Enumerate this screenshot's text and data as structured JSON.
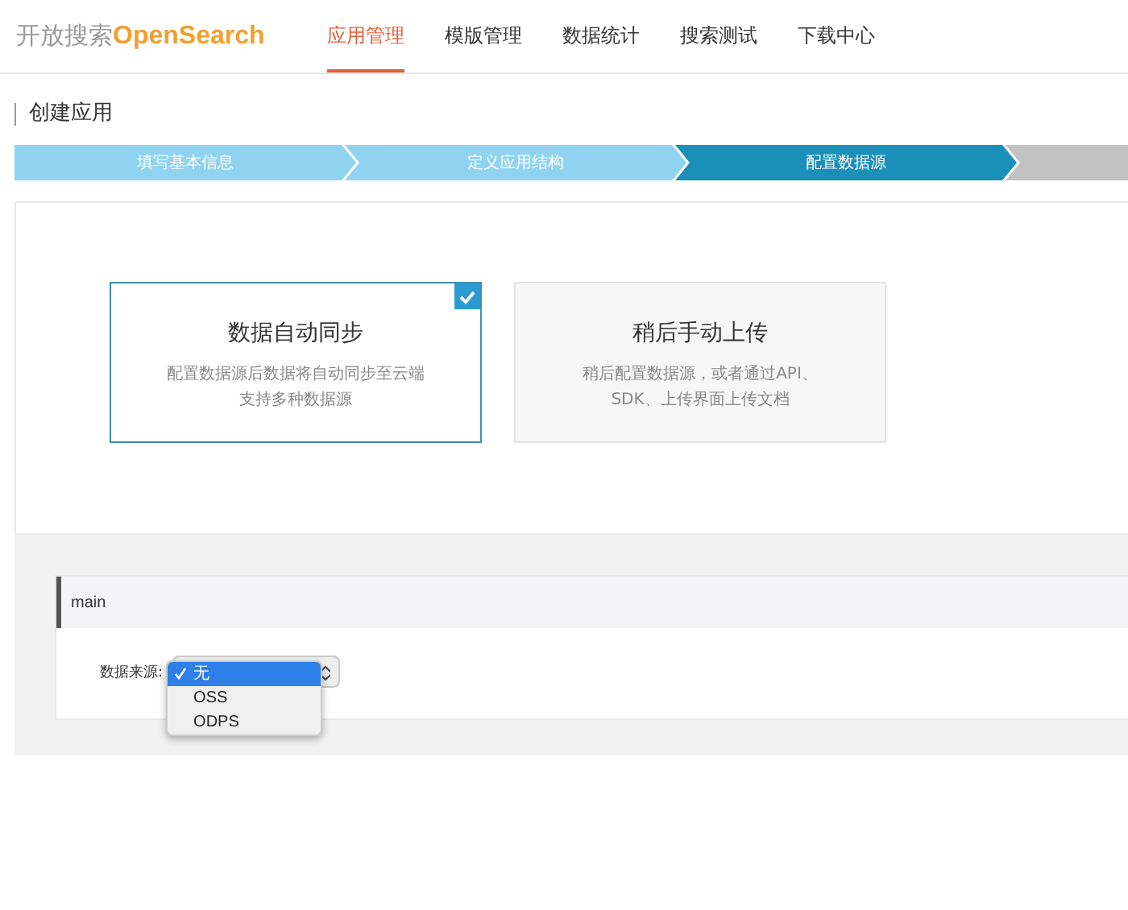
{
  "brand": {
    "prefix": "开放搜索",
    "name": "OpenSearch"
  },
  "nav": [
    {
      "label": "应用管理",
      "selected": true
    },
    {
      "label": "模版管理",
      "selected": false
    },
    {
      "label": "数据统计",
      "selected": false
    },
    {
      "label": "搜索测试",
      "selected": false
    },
    {
      "label": "下载中心",
      "selected": false
    }
  ],
  "page_title": "创建应用",
  "steps": [
    {
      "label": "填写基本信息",
      "done": true,
      "selected": false
    },
    {
      "label": "定义应用结构",
      "done": true,
      "selected": false
    },
    {
      "label": "配置数据源",
      "done": false,
      "selected": true
    },
    {
      "done": false,
      "selected": false
    }
  ],
  "sync_options": [
    {
      "title": "数据自动同步",
      "lines": [
        "配置数据源后数据将自动同步至云端",
        "支持多种数据源"
      ],
      "selected": true
    },
    {
      "title": "稍后手动上传",
      "lines": [
        "稍后配置数据源，或者通过API、",
        "SDK、上传界面上传文档"
      ],
      "selected": false
    }
  ],
  "table_section": {
    "name": "main",
    "field_label": "数据来源:",
    "options": [
      {
        "label": "无",
        "selected": true
      },
      {
        "label": "OSS",
        "selected": false
      },
      {
        "label": "ODPS",
        "selected": false
      }
    ]
  }
}
